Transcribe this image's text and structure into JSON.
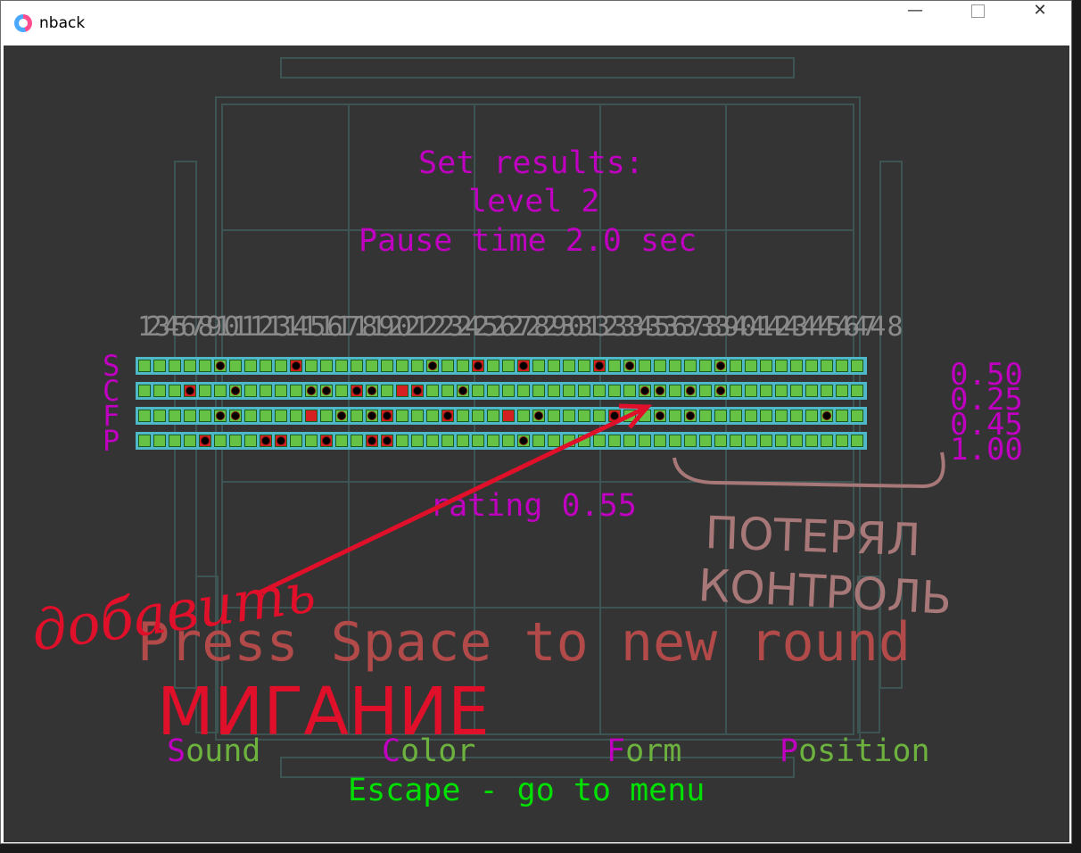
{
  "window": {
    "title": "nback",
    "controls": [
      "minimize-icon",
      "maximize-icon",
      "close-icon"
    ]
  },
  "results": {
    "heading": "Set results:",
    "level": "level 2",
    "pause": "Pause time 2.0 sec",
    "numbers": "12345678910111213141516171819202122232425262728293031323334353637383940414243444546474 8",
    "rating": "rating 0.55"
  },
  "rows": [
    {
      "letter": "S",
      "score": "0.50",
      "marks": {
        "dots": [
          5,
          19,
          32,
          38
        ],
        "rdots": [
          10,
          22,
          25,
          30
        ],
        "red": []
      }
    },
    {
      "letter": "C",
      "score": "0.25",
      "marks": {
        "dots": [
          6,
          11,
          12,
          15,
          21,
          33,
          34,
          36,
          38
        ],
        "rdots": [
          3,
          14,
          18
        ],
        "red": [
          17
        ]
      }
    },
    {
      "letter": "F",
      "score": "0.45",
      "marks": {
        "dots": [
          5,
          6,
          13,
          15,
          26,
          34,
          36,
          45
        ],
        "rdots": [
          16,
          20,
          31
        ],
        "red": [
          11,
          24
        ]
      }
    },
    {
      "letter": "P",
      "score": "1.00",
      "marks": {
        "dots": [
          25
        ],
        "rdots": [
          4,
          8,
          9,
          12,
          15,
          16
        ],
        "red": []
      }
    }
  ],
  "prompt": "Press Space to new round",
  "modalities": [
    {
      "first": "S",
      "rest": "ound"
    },
    {
      "first": "C",
      "rest": "olor"
    },
    {
      "first": "F",
      "rest": "orm"
    },
    {
      "first": "P",
      "rest": "osition"
    }
  ],
  "escape": "Escape - go to menu",
  "annotations": {
    "lost_control_1": "ПОТЕРЯЛ",
    "lost_control_2": "КОНТРОЛЬ",
    "add_1": "добавить",
    "add_2": "МИГАНИЕ"
  },
  "colors": {
    "accent": "#c000c0",
    "cell": "#66c245",
    "border": "#4fb8c8",
    "annotation_red": "#e0102a",
    "annotation_brown": "#a87878"
  }
}
